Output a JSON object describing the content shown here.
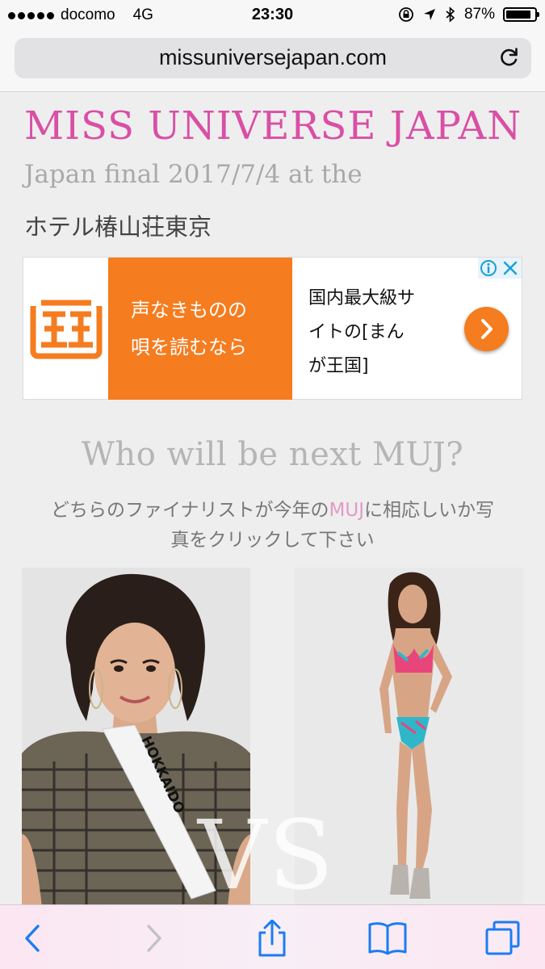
{
  "status_bar": {
    "carrier": "docomo",
    "network": "4G",
    "time": "23:30",
    "battery_text": "87%",
    "battery_level_percent": 87
  },
  "url_bar": {
    "domain": "missuniversejapan.com"
  },
  "page": {
    "title": "MISS UNIVERSE JAPAN",
    "final_line": "Japan final 2017/7/4 at the",
    "venue": "ホテル椿山荘東京",
    "heading": "Who will be next MUJ?",
    "instruction_before": "どちらのファイナリストが今年の",
    "instruction_highlight": "MUJ",
    "instruction_after": "に相応しいか写真をクリックして下さい",
    "vs_label": "VS",
    "sash_text": "HOKKAIDO"
  },
  "ad": {
    "orange_line1": "声なきものの",
    "orange_line2": "唄を読むなら",
    "copy_line1": "国内最大級サ",
    "copy_line2": "イトの[まん",
    "copy_line3": "が王国]"
  },
  "colors": {
    "title_pink": "#d94fa6",
    "ad_orange": "#f57c1f",
    "ios_blue": "#1a7cf5"
  },
  "icons": {
    "reload": "reload-icon",
    "back": "chevron-left-icon",
    "forward": "chevron-right-icon",
    "share": "share-icon",
    "bookmarks": "book-icon",
    "tabs": "tabs-icon",
    "ad_info": "info-icon",
    "ad_close": "close-icon"
  }
}
